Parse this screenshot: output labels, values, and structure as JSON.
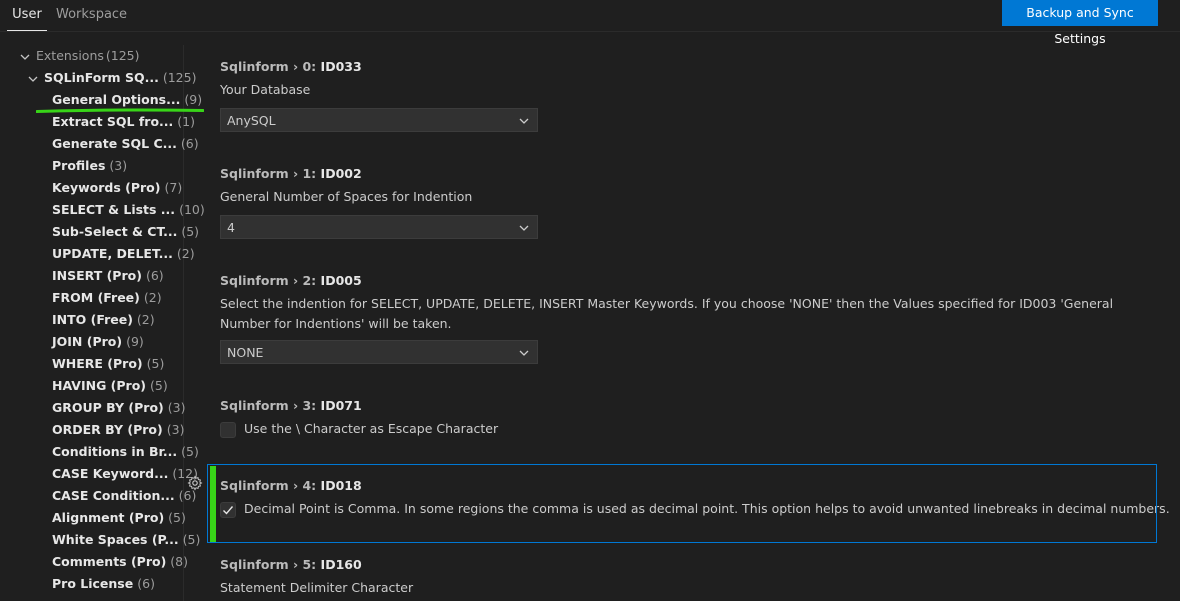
{
  "tabs": {
    "user": "User",
    "workspace": "Workspace"
  },
  "sync_button": "Backup and Sync Settings",
  "tree": {
    "extensions": {
      "label": "Extensions",
      "count": "(125)"
    },
    "extension": {
      "label": "SQLinForm SQ...",
      "count": "(125)"
    },
    "items": [
      {
        "label": "General Options...",
        "count": "(9)"
      },
      {
        "label": "Extract SQL fro...",
        "count": "(1)"
      },
      {
        "label": "Generate SQL C...",
        "count": "(6)"
      },
      {
        "label": "Profiles",
        "count": "(3)"
      },
      {
        "label": "Keywords (Pro)",
        "count": "(7)"
      },
      {
        "label": "SELECT & Lists ...",
        "count": "(10)"
      },
      {
        "label": "Sub-Select & CT...",
        "count": "(5)"
      },
      {
        "label": "UPDATE, DELET...",
        "count": "(2)"
      },
      {
        "label": "INSERT (Pro)",
        "count": "(6)"
      },
      {
        "label": "FROM (Free)",
        "count": "(2)"
      },
      {
        "label": "INTO (Free)",
        "count": "(2)"
      },
      {
        "label": "JOIN (Pro)",
        "count": "(9)"
      },
      {
        "label": "WHERE (Pro)",
        "count": "(5)"
      },
      {
        "label": "HAVING (Pro)",
        "count": "(5)"
      },
      {
        "label": "GROUP BY (Pro)",
        "count": "(3)"
      },
      {
        "label": "ORDER BY (Pro)",
        "count": "(3)"
      },
      {
        "label": "Conditions in Br...",
        "count": "(5)"
      },
      {
        "label": "CASE Keyword...",
        "count": "(12)"
      },
      {
        "label": "CASE Condition...",
        "count": "(6)"
      },
      {
        "label": "Alignment (Pro)",
        "count": "(5)"
      },
      {
        "label": "White Spaces (P...",
        "count": "(5)"
      },
      {
        "label": "Comments (Pro)",
        "count": "(8)"
      },
      {
        "label": "Pro License",
        "count": "(6)"
      }
    ]
  },
  "settings": [
    {
      "category": "Sqlinform › 0: ",
      "key": "ID033",
      "description": "Your Database",
      "value": "AnySQL"
    },
    {
      "category": "Sqlinform › 1: ",
      "key": "ID002",
      "description": "General Number of Spaces for Indention",
      "value": "4"
    },
    {
      "category": "Sqlinform › 2: ",
      "key": "ID005",
      "description": "Select the indention for SELECT, UPDATE, DELETE, INSERT Master Keywords. If you choose 'NONE' then the Values specified for ID003 'General Number for Indentions' will be taken.",
      "value": "NONE"
    },
    {
      "category": "Sqlinform › 3: ",
      "key": "ID071",
      "description": "Use the \\ Character as Escape Character",
      "checked": false
    },
    {
      "category": "Sqlinform › 4: ",
      "key": "ID018",
      "description": "Decimal Point is Comma. In some regions the comma is used as decimal point. This option helps to avoid unwanted linebreaks in decimal numbers.",
      "checked": true
    },
    {
      "category": "Sqlinform › 5: ",
      "key": "ID160",
      "description": "Statement Delimiter Character"
    }
  ],
  "colors": {
    "accent": "#0078d4",
    "highlight": "#38d418",
    "background": "#1f1f1f"
  }
}
